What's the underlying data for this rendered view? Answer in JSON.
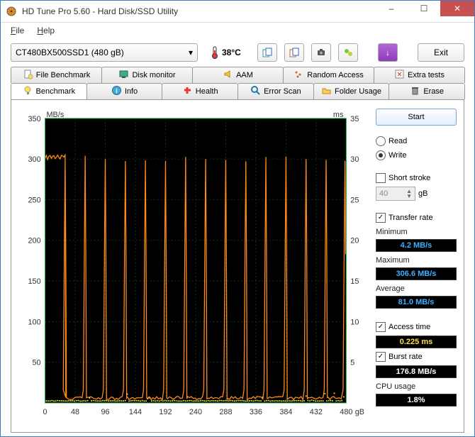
{
  "window": {
    "title": "HD Tune Pro 5.60 - Hard Disk/SSD Utility"
  },
  "menu": {
    "file": "File",
    "help": "Help"
  },
  "toolbar": {
    "device": "CT480BX500SSD1 (480 gB)",
    "temperature": "38°C",
    "exit": "Exit"
  },
  "tabs_row1": [
    {
      "label": "File Benchmark",
      "icon": "file-bench-icon"
    },
    {
      "label": "Disk monitor",
      "icon": "monitor-icon"
    },
    {
      "label": "AAM",
      "icon": "speaker-icon"
    },
    {
      "label": "Random Access",
      "icon": "random-icon"
    },
    {
      "label": "Extra tests",
      "icon": "tool-icon"
    }
  ],
  "tabs_row2": [
    {
      "label": "Benchmark",
      "icon": "bulb-icon",
      "active": true
    },
    {
      "label": "Info",
      "icon": "info-icon"
    },
    {
      "label": "Health",
      "icon": "health-icon"
    },
    {
      "label": "Error Scan",
      "icon": "lens-icon"
    },
    {
      "label": "Folder Usage",
      "icon": "folder-icon"
    },
    {
      "label": "Erase",
      "icon": "trash-icon"
    }
  ],
  "side": {
    "start": "Start",
    "read": "Read",
    "write": "Write",
    "short_stroke": "Short stroke",
    "short_stroke_value": "40",
    "short_stroke_unit": "gB",
    "transfer_rate": "Transfer rate",
    "minimum_label": "Minimum",
    "minimum": "4.2 MB/s",
    "maximum_label": "Maximum",
    "maximum": "306.6 MB/s",
    "average_label": "Average",
    "average": "81.0 MB/s",
    "access_time_label": "Access time",
    "access_time": "0.225 ms",
    "burst_rate_label": "Burst rate",
    "burst_rate": "176.8 MB/s",
    "cpu_usage_label": "CPU usage",
    "cpu_usage": "1.8%"
  },
  "chart_data": {
    "type": "line",
    "title": "",
    "x_unit": "gB",
    "y_left_unit": "MB/s",
    "y_right_unit": "ms",
    "x_ticks": [
      0,
      48,
      96,
      144,
      192,
      240,
      288,
      336,
      384,
      432,
      480
    ],
    "y_left_ticks": [
      0,
      50,
      100,
      150,
      200,
      250,
      300,
      350
    ],
    "y_right_ticks": [
      0,
      5,
      10,
      15,
      20,
      25,
      30,
      35
    ],
    "xlim": [
      0,
      480
    ],
    "ylim_left": [
      0,
      350
    ],
    "ylim_right": [
      0,
      35
    ],
    "series": [
      {
        "name": "Transfer rate (MB/s)",
        "axis": "left",
        "color": "#ff8c1a",
        "pattern": "periodic_spikes",
        "peak_value": 305,
        "trough_value": 4,
        "period_gB": 32,
        "initial_plateau": {
          "x_start": 0,
          "x_end": 32,
          "y": 302
        },
        "peaks_x": [
          32,
          64,
          96,
          128,
          160,
          192,
          224,
          256,
          288,
          320,
          352,
          384,
          416,
          448,
          478
        ]
      },
      {
        "name": "Access time (ms)",
        "axis": "right",
        "color": "#f7e943",
        "pattern": "flat_with_jitter",
        "baseline": 0.22,
        "jitter_max": 1.0
      }
    ]
  }
}
